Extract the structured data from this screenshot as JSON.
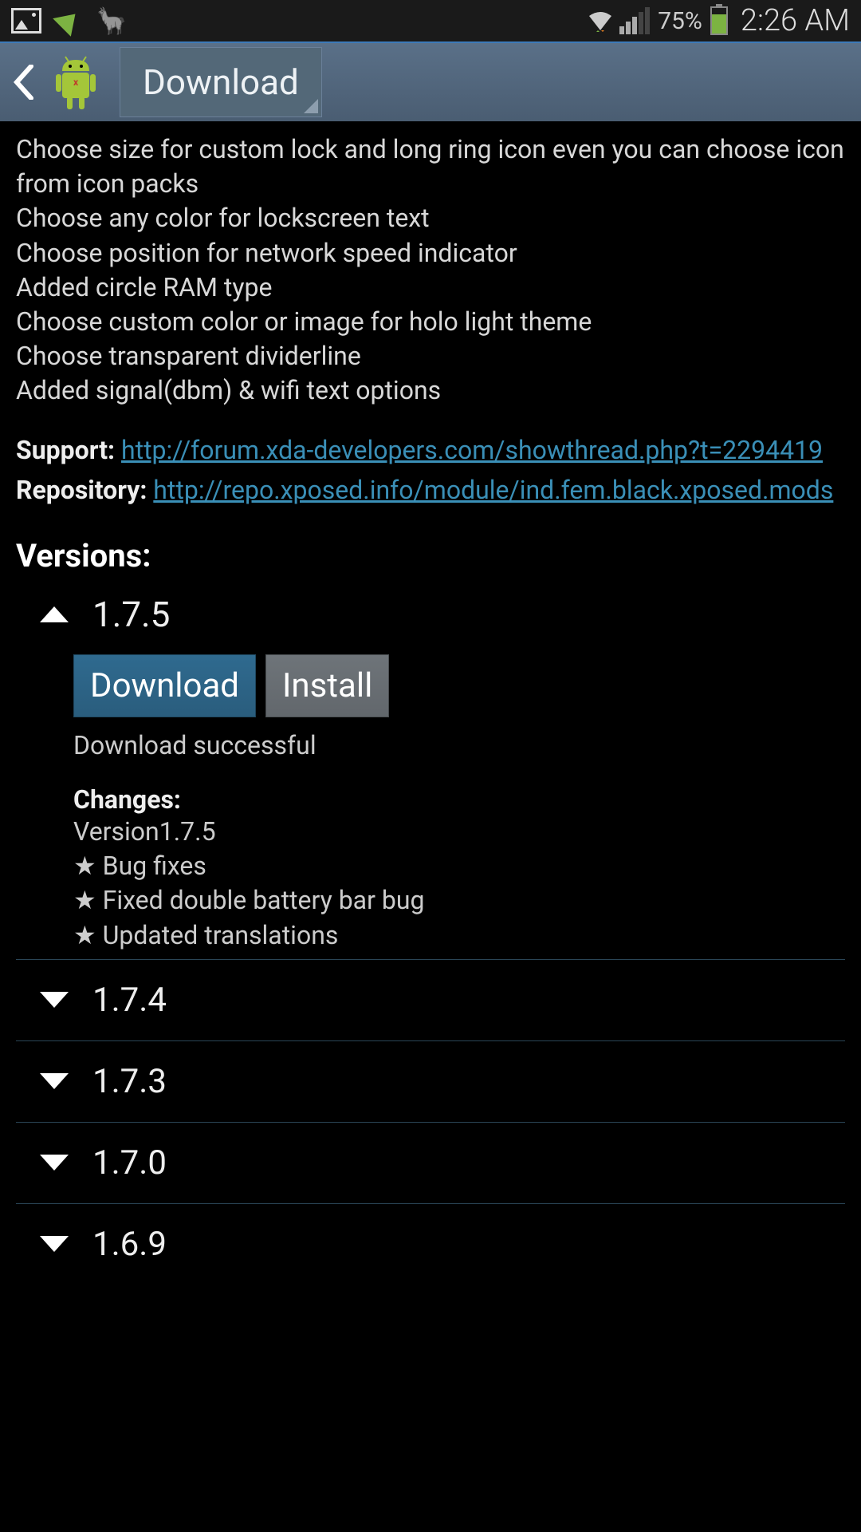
{
  "status_bar": {
    "battery_pct": "75%",
    "time": "2:26 AM"
  },
  "app_bar": {
    "title": "Download"
  },
  "description": {
    "lines": [
      "Choose size for custom lock and long ring icon even you can choose icon from icon packs",
      "Choose any color for lockscreen text",
      "Choose position for network speed indicator",
      "Added circle RAM type",
      "Choose custom color or image for holo light theme",
      "Choose transparent dividerline",
      "Added signal(dbm) & wifi text options"
    ]
  },
  "meta": {
    "support_label": "Support:",
    "support_url": "http://forum.xda-developers.com/showthread.php?t=2294419",
    "repo_label": "Repository:",
    "repo_url": "http://repo.xposed.info/module/ind.fem.black.xposed.mods"
  },
  "versions_heading": "Versions:",
  "expanded": {
    "number": "1.7.5",
    "download_label": "Download",
    "install_label": "Install",
    "status": "Download successful",
    "changes_heading": "Changes:",
    "changes": [
      "Version1.7.5",
      "★ Bug fixes",
      "★ Fixed double battery bar bug",
      "★ Updated translations"
    ]
  },
  "collapsed": [
    "1.7.4",
    "1.7.3",
    "1.7.0",
    "1.6.9"
  ]
}
